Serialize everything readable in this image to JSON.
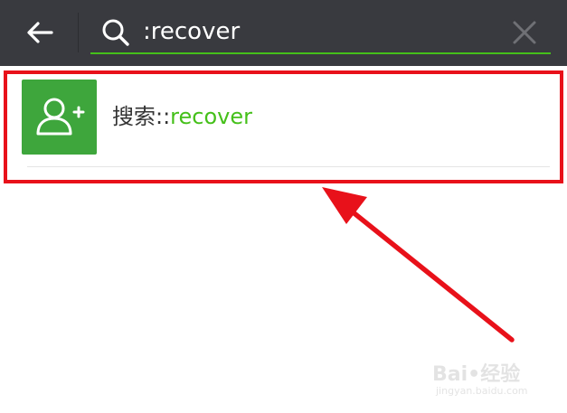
{
  "search": {
    "value": ":recover"
  },
  "result": {
    "prefix": "搜索::",
    "keyword": "recover"
  },
  "watermark": {
    "main": "Bai•经验",
    "sub": "jingyan.baidu.com"
  },
  "icons": {
    "back": "back-arrow-icon",
    "search": "search-icon",
    "clear": "close-icon",
    "avatar": "add-contact-icon"
  },
  "colors": {
    "topbar": "#393a3f",
    "accent_green": "#45c01a",
    "avatar_bg": "#3ea63c",
    "highlight_red": "#e8111a"
  }
}
